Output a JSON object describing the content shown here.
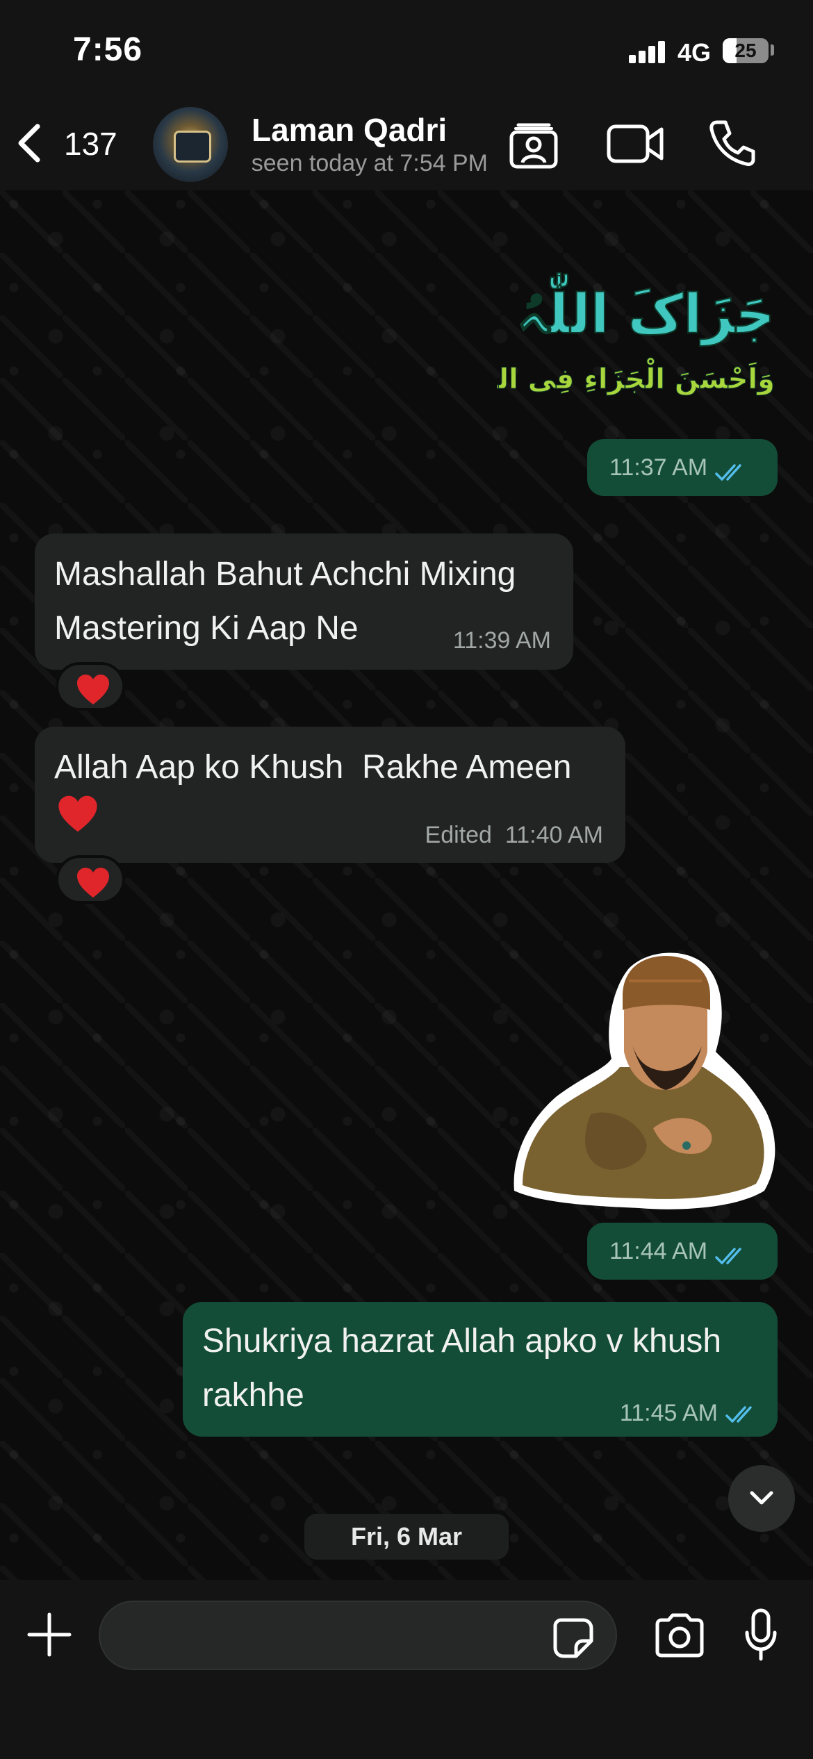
{
  "status_bar": {
    "time": "7:56",
    "network": "4G",
    "battery": "25"
  },
  "header": {
    "back_count": "137",
    "contact_name": "Laman Qadri",
    "contact_status": "last seen today at 7:54 PM"
  },
  "messages": [
    {
      "type": "sticker",
      "direction": "outgoing",
      "sticker_text_line1": "جَزَاکَ اللّٰہُ خَیْرًا",
      "sticker_text_line2": "وَاَحْسَنَ الْجَزَاءِ فِی الدُّنْیَا وَالْآخِرَۃ",
      "time": "11:37 AM",
      "status": "read"
    },
    {
      "type": "text",
      "direction": "incoming",
      "text": "Mashallah Bahut Achchi Mixing\nMastering Ki Aap Ne",
      "time": "11:39 AM",
      "reaction": "red-heart"
    },
    {
      "type": "text",
      "direction": "incoming",
      "text": "Allah Aap ko Khush  Rakhe Ameen\n",
      "emoji": "red-heart",
      "edited_label": "Edited",
      "time": "11:40 AM",
      "reaction": "red-heart"
    },
    {
      "type": "sticker",
      "direction": "outgoing",
      "time": "11:44 AM",
      "status": "read"
    },
    {
      "type": "text",
      "direction": "outgoing",
      "text": "Shukriya hazrat Allah apko v khush\nrakhhe",
      "time": "11:45 AM",
      "status": "read"
    }
  ],
  "date_separator": "Fri, 6 Mar",
  "input": {
    "value": "",
    "placeholder": ""
  },
  "colors": {
    "background": "#0b0b0b",
    "incoming_bubble": "#222424",
    "outgoing_bubble": "#134d37",
    "read_tick": "#53bdeb"
  },
  "icons": [
    "chevron-left-icon",
    "contact-card-icon",
    "video-camera-icon",
    "phone-icon",
    "chevron-down-icon",
    "plus-icon",
    "sticker-icon",
    "camera-icon",
    "microphone-icon",
    "double-check-icon",
    "red-heart-icon"
  ]
}
